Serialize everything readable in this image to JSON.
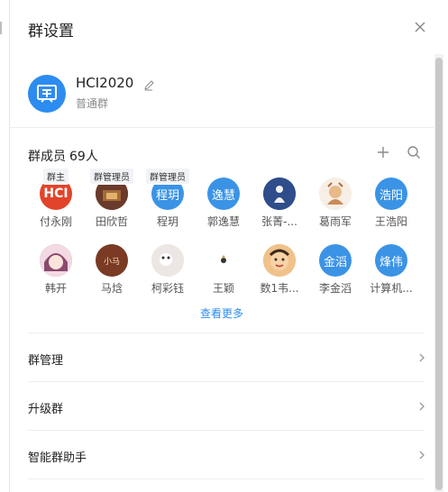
{
  "header": {
    "title": "群设置"
  },
  "group": {
    "name": "HCI2020",
    "type": "普通群"
  },
  "members": {
    "label": "群成员",
    "count": "69人",
    "row1": [
      {
        "name": "付永刚",
        "badge": "群主",
        "avatar_text": "HCI",
        "color": "#e1442a"
      },
      {
        "name": "田欣哲",
        "badge": "群管理员",
        "avatar_text": "",
        "color": "#6a3a2a"
      },
      {
        "name": "程玥",
        "badge": "群管理员",
        "avatar_text": "程玥",
        "color": "#3b93e6"
      },
      {
        "name": "郭逸慧",
        "badge": "",
        "avatar_text": "逸慧",
        "color": "#3b93e6"
      },
      {
        "name": "张菁-...",
        "badge": "",
        "avatar_text": "",
        "color": "#2f4d8a"
      },
      {
        "name": "葛雨军",
        "badge": "",
        "avatar_text": "",
        "color": "#f3e6d8"
      },
      {
        "name": "王浩阳",
        "badge": "",
        "avatar_text": "浩阳",
        "color": "#3b93e6"
      }
    ],
    "row2": [
      {
        "name": "韩开",
        "avatar_text": "",
        "color": "#b06a8c"
      },
      {
        "name": "马焓",
        "avatar_text": "小马",
        "color": "#7a3a24"
      },
      {
        "name": "柯彩钰",
        "avatar_text": "",
        "color": "#e7e2e0"
      },
      {
        "name": "王颖",
        "avatar_text": "",
        "color": "#ffffff"
      },
      {
        "name": "数1韦...",
        "avatar_text": "",
        "color": "#d9a46a"
      },
      {
        "name": "李金滔",
        "avatar_text": "金滔",
        "color": "#3b93e6"
      },
      {
        "name": "计算机...",
        "avatar_text": "烽伟",
        "color": "#3b93e6"
      }
    ],
    "view_more": "查看更多"
  },
  "settings": [
    {
      "label": "群管理"
    },
    {
      "label": "升级群"
    },
    {
      "label": "智能群助手"
    }
  ],
  "colors": {
    "accent": "#2d8cf0"
  },
  "icons": [
    "close-icon",
    "edit-icon",
    "plus-icon",
    "search-icon",
    "chevron-right-icon"
  ]
}
